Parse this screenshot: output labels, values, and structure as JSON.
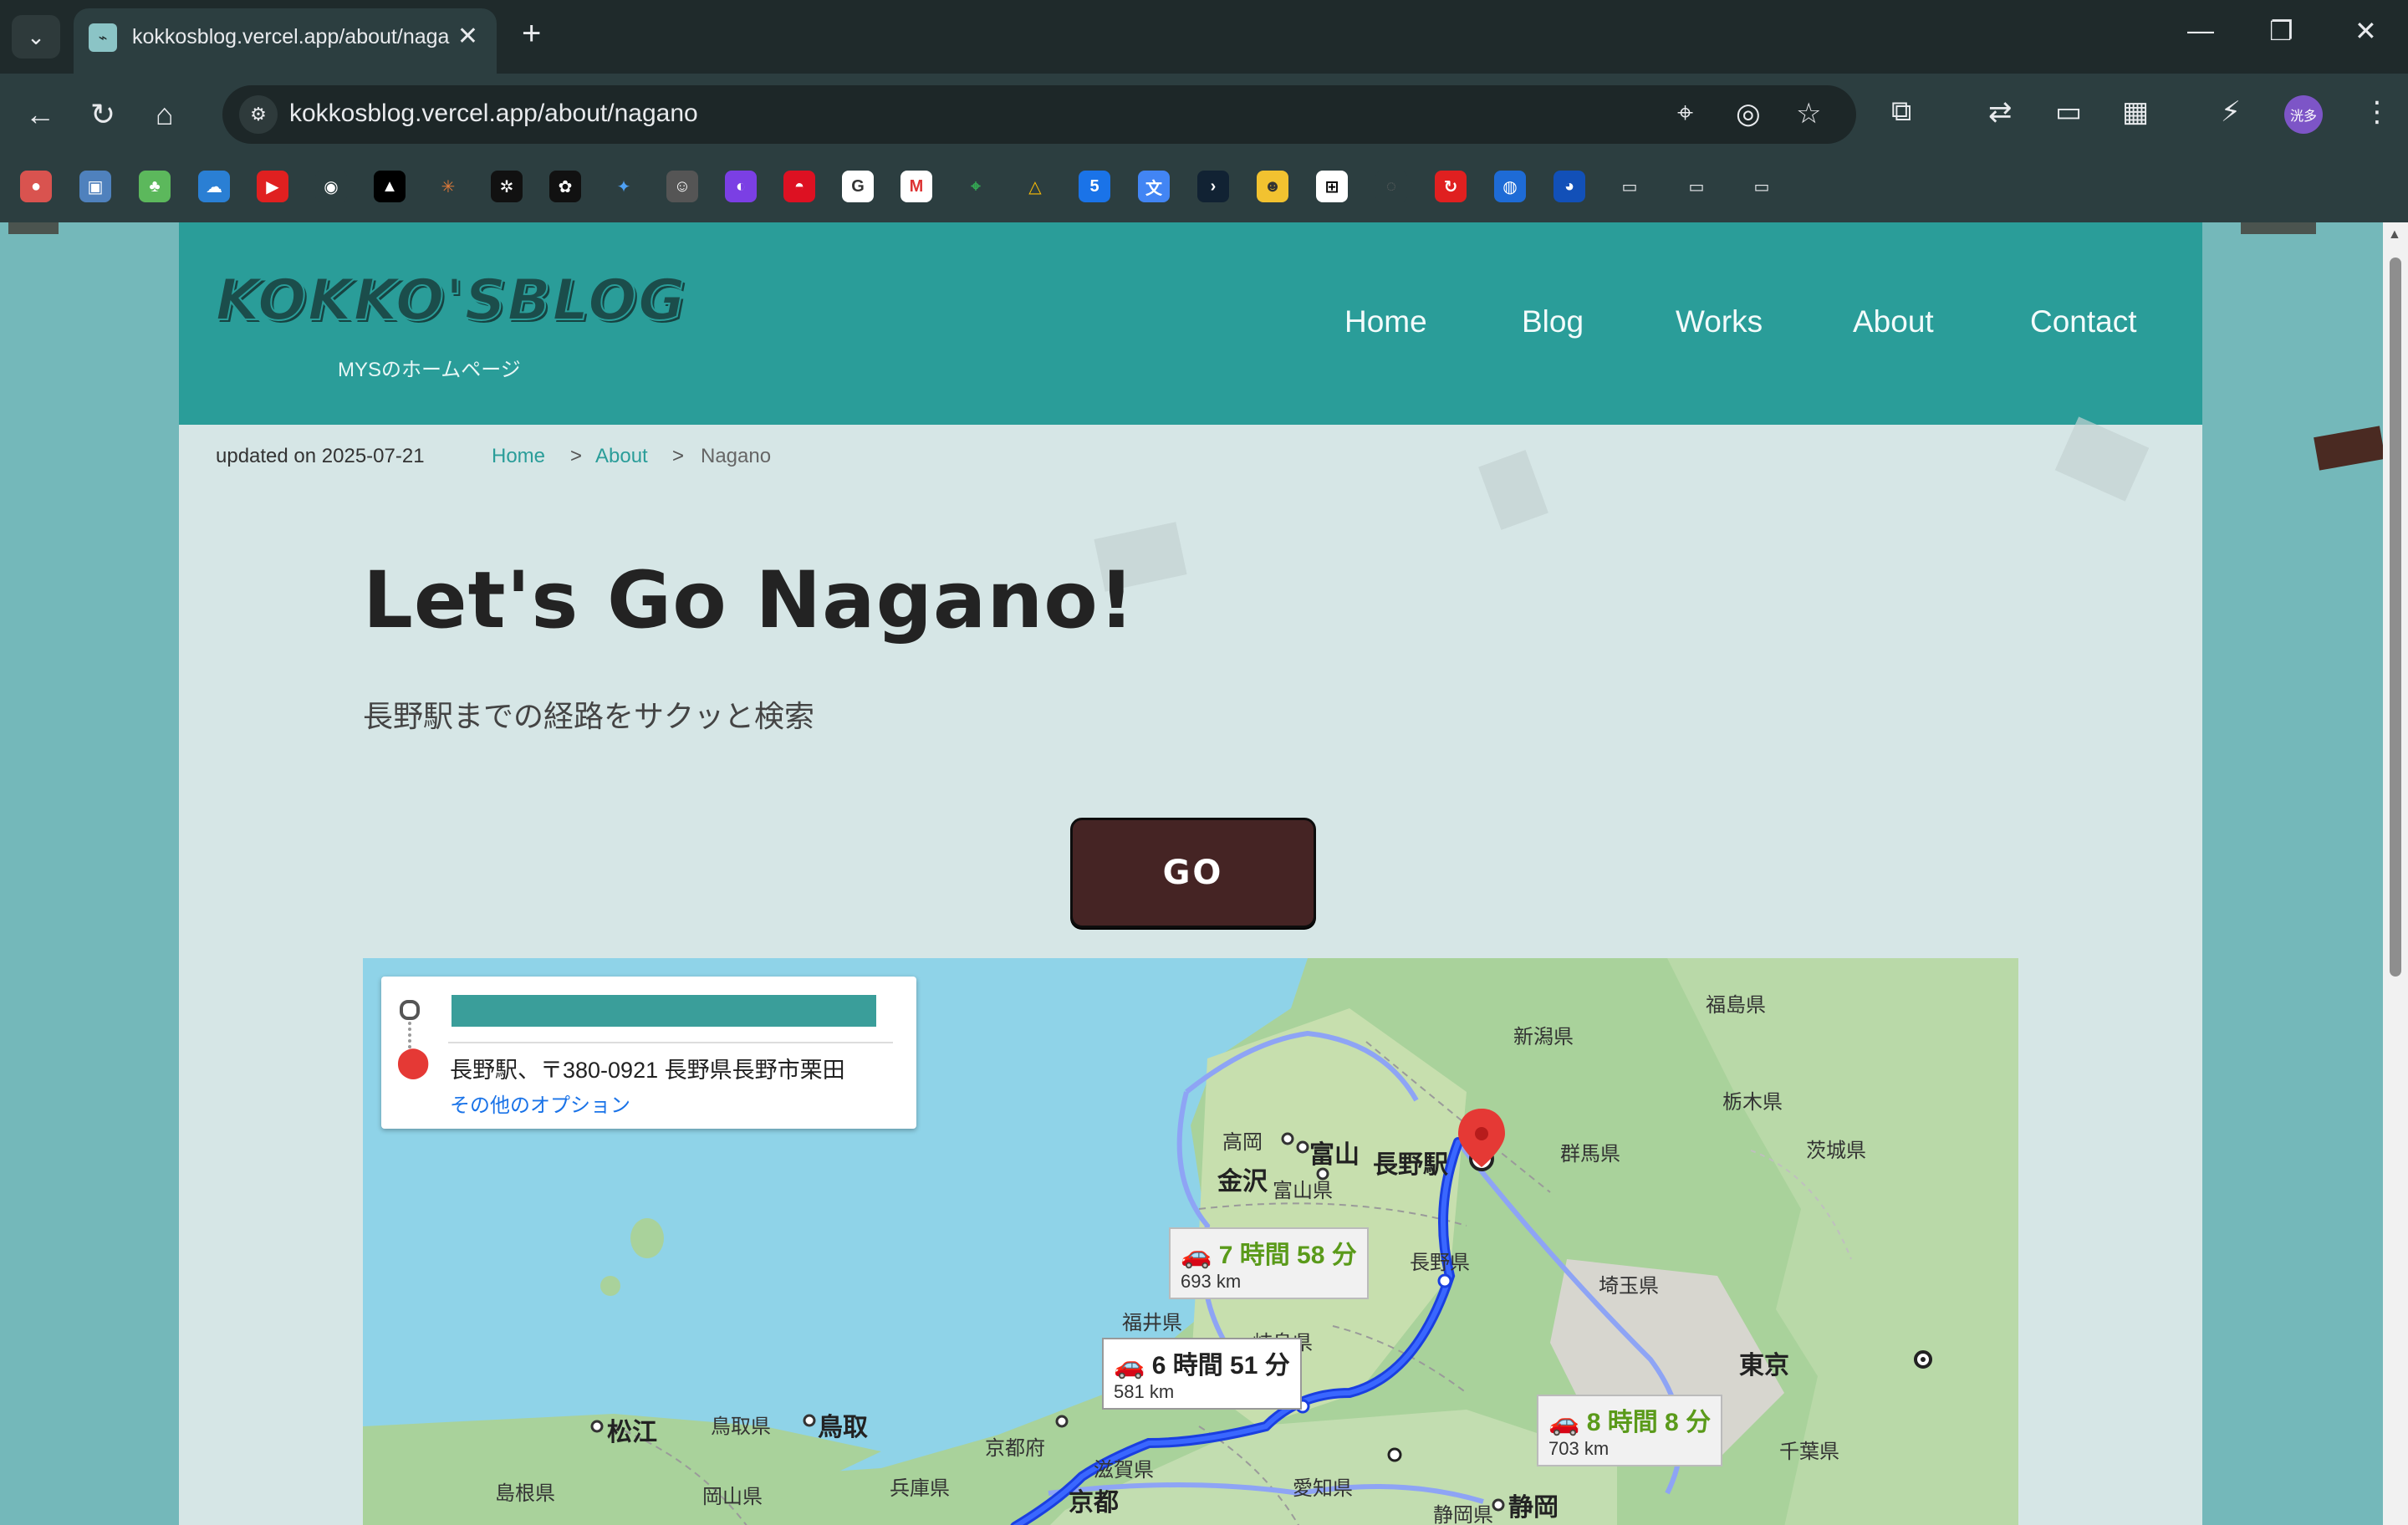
{
  "browser": {
    "tab_title": "kokkosblog.vercel.app/about/naga",
    "url": "kokkosblog.vercel.app/about/nagano",
    "profile_label": "洸多"
  },
  "site": {
    "logo": "KOKKO'SBLOG",
    "logo_sub": "MYSのホームページ",
    "nav": [
      "Home",
      "Blog",
      "Works",
      "About",
      "Contact"
    ],
    "updated": "updated on 2025-07-21",
    "breadcrumb": [
      "Home",
      "About",
      "Nagano"
    ],
    "breadcrumb_sep": ">",
    "title": "Let's Go Nagano!",
    "lead": "長野駅までの経路をサクッと検索",
    "go_button": "GO"
  },
  "map": {
    "destination": "長野駅、〒380-0921 長野県長野市栗田",
    "more_options": "その他のオプション",
    "routes": [
      {
        "time": "6 時間 51 分",
        "distance": "581 km"
      },
      {
        "time": "7 時間 58 分",
        "distance": "693 km"
      },
      {
        "time": "8 時間 8 分",
        "distance": "703 km"
      }
    ],
    "labels": {
      "niigata": "新潟県",
      "fukushima": "福島県",
      "tochigi": "栃木県",
      "gunma": "群馬県",
      "ibaraki": "茨城県",
      "saitama": "埼玉県",
      "chiba": "千葉県",
      "tokyo": "東京",
      "nagano_station": "長野駅",
      "nagano_pref": "長野県",
      "takaoka": "高岡",
      "toyama": "富山",
      "toyama_pref": "富山県",
      "kanazawa": "金沢",
      "fukui_pref": "福井県",
      "gifu_pref": "岐阜県",
      "kyoto_pref": "京都府",
      "kyoto": "京都",
      "shiga_pref": "滋賀県",
      "hyogo_pref": "兵庫県",
      "aichi_pref": "愛知県",
      "shizuoka_pref": "静岡県",
      "shizuoka": "静岡",
      "tottori_pref": "鳥取県",
      "tottori": "鳥取",
      "matsue": "松江",
      "shimane_pref": "島根県",
      "okayama_pref": "岡山県"
    }
  }
}
